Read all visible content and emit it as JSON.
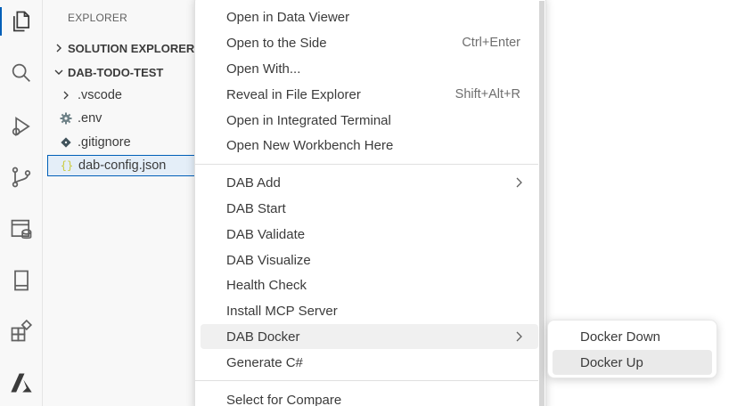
{
  "activity_bar": {
    "icons": [
      "files-icon",
      "search-icon",
      "run-debug-icon",
      "source-control-icon",
      "remote-data-icon",
      "book-icon",
      "extensions-icon",
      "azure-icon"
    ]
  },
  "sidebar": {
    "title": "EXPLORER",
    "sections": [
      {
        "label": "SOLUTION EXPLORER",
        "expanded": false
      },
      {
        "label": "DAB-TODO-TEST",
        "expanded": true
      }
    ],
    "tree": [
      {
        "label": ".vscode",
        "icon": "chevron-right-icon"
      },
      {
        "label": ".env",
        "icon": "gear-icon"
      },
      {
        "label": ".gitignore",
        "icon": "git-icon"
      },
      {
        "label": "dab-config.json",
        "icon": "json-braces-icon",
        "selected": true
      }
    ]
  },
  "context_menu": {
    "groups": [
      [
        {
          "label": "Open in Data Viewer"
        },
        {
          "label": "Open to the Side",
          "shortcut": "Ctrl+Enter"
        },
        {
          "label": "Open With..."
        },
        {
          "label": "Reveal in File Explorer",
          "shortcut": "Shift+Alt+R"
        },
        {
          "label": "Open in Integrated Terminal"
        },
        {
          "label": "Open New Workbench Here"
        }
      ],
      [
        {
          "label": "DAB Add",
          "submenu": true
        },
        {
          "label": "DAB Start"
        },
        {
          "label": "DAB Validate"
        },
        {
          "label": "DAB Visualize"
        },
        {
          "label": "Health Check"
        },
        {
          "label": "Install MCP Server"
        },
        {
          "label": "DAB Docker",
          "submenu": true,
          "hover": true
        },
        {
          "label": "Generate C#"
        }
      ],
      [
        {
          "label": "Select for Compare"
        }
      ]
    ]
  },
  "submenu": {
    "items": [
      {
        "label": "Docker Down"
      },
      {
        "label": "Docker Up",
        "hover": true
      }
    ]
  },
  "colors": {
    "accent": "#005fb8",
    "hover_bg": "#f0f0f0",
    "json_icon": "#cbcb41"
  }
}
